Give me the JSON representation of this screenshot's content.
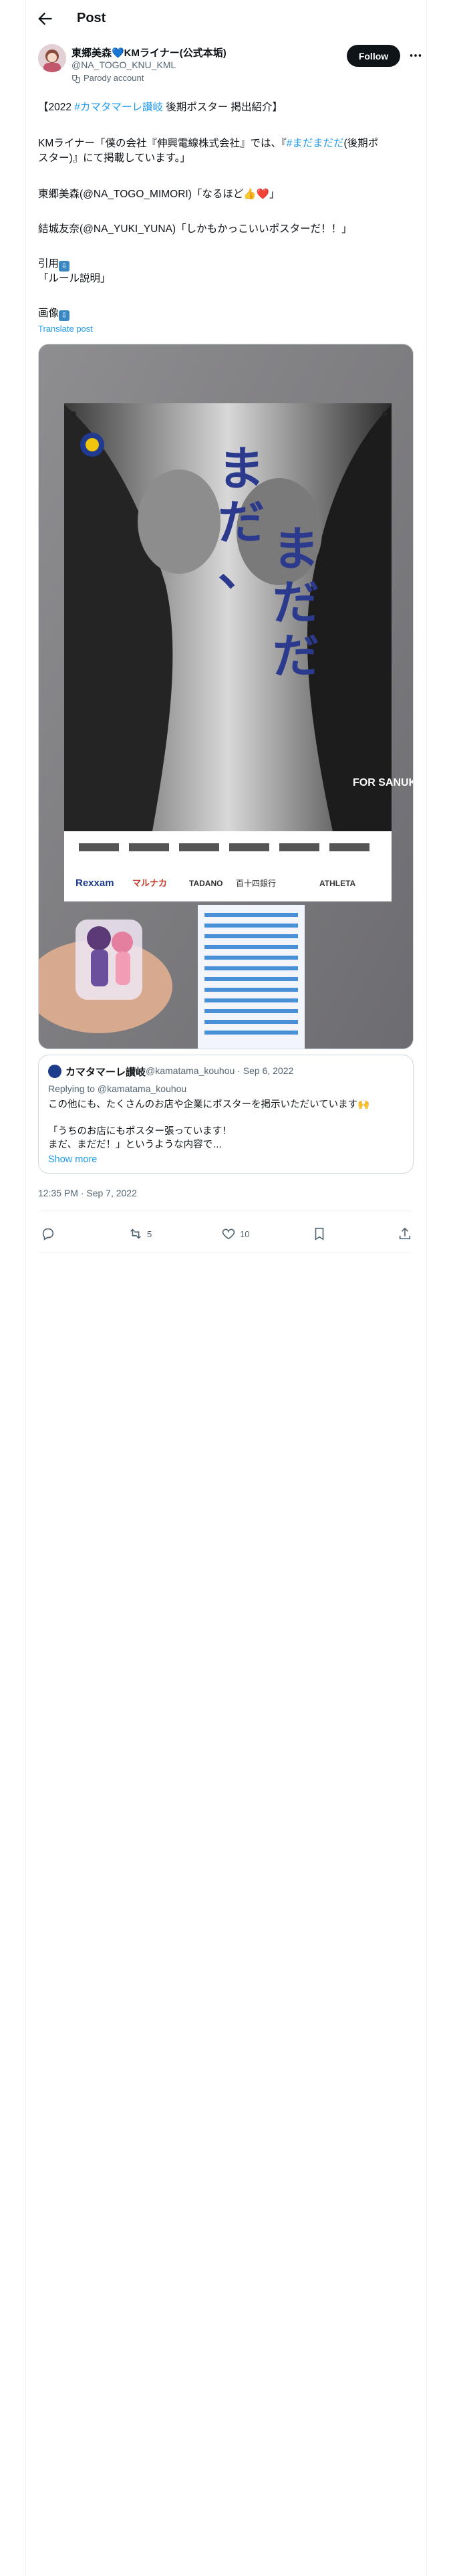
{
  "header": {
    "title": "Post"
  },
  "author": {
    "name": "東郷美森💙KMライナー(公式本垢)",
    "handle": "@NA_TOGO_KNU_KML",
    "parody_label": "Parody account"
  },
  "follow_label": "Follow",
  "post": {
    "line1_pre": "【2022 ",
    "line1_tag": "#カマタマーレ讃岐",
    "line1_post": " 後期ポスター 掲出紹介】",
    "line2_pre": "KMライナー「僕の会社『伸興電線株式会社』では、『",
    "line2_tag": "#まだまだだ",
    "line2_post": "(後期ポ",
    "line3": "スター)』にて掲載しています。」",
    "line4": "東郷美森(@NA_TOGO_MIMORI)「なるほど👍❤️」",
    "line5": "結城友奈(@NA_YUKI_YUNA)「しかもかっこいいポスターだ！！」",
    "line6": "引用",
    "line7": "「ルール説明」",
    "line8": "画像",
    "translate": "Translate post"
  },
  "poster": {
    "headline_chars": [
      "ま",
      "だ",
      "、",
      "ま",
      "だ",
      "だ"
    ],
    "sponsor_logos": [
      "Rexxam",
      "マルナカ",
      "TADANO",
      "百十四銀行",
      "ATHLETA"
    ],
    "vertical_text": "FOR SANUKI"
  },
  "quote": {
    "name": "カマタマーレ讃岐",
    "handle": "@kamatama_kouhou",
    "date": "Sep 6, 2022",
    "replying_to": "Replying to @kamatama_kouhou",
    "line1": "この他にも、たくさんのお店や企業にポスターを掲示いただいています🙌",
    "line2": "「うちのお店にもポスター張っています！",
    "line3": "まだ、まだだ！」というような内容で…",
    "show_more": "Show more"
  },
  "timestamp": "12:35 PM · Sep 7, 2022",
  "actions": {
    "replies": "",
    "reposts": "5",
    "likes": "10"
  },
  "colors": {
    "accent": "#1d9bf0",
    "text": "#0f1419",
    "muted": "#536471",
    "border": "#cfd9de"
  }
}
